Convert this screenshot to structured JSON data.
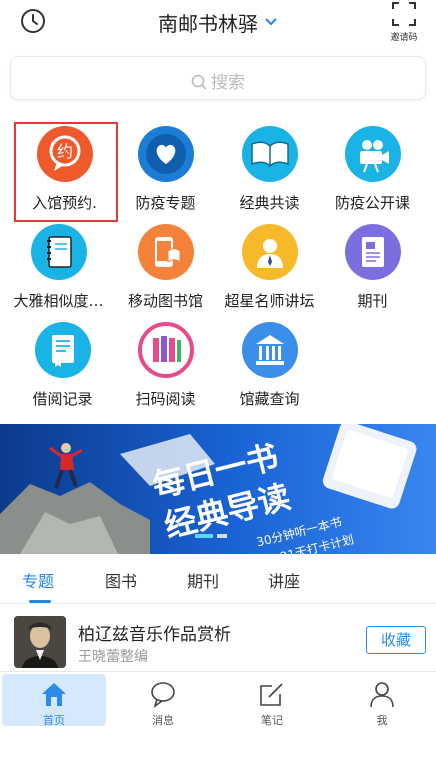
{
  "header": {
    "title": "南邮书林驿",
    "invite_label": "邀请码"
  },
  "search": {
    "placeholder": "搜索"
  },
  "grid": {
    "items": [
      {
        "label": "入馆预约.",
        "icon": "appointment-icon",
        "color": "#ef5a2c",
        "glyph": "约"
      },
      {
        "label": "防疫专题",
        "icon": "heart-icon",
        "color": "#1b7dd6"
      },
      {
        "label": "经典共读",
        "icon": "open-book-icon",
        "color": "#19b3e6"
      },
      {
        "label": "防疫公开课",
        "icon": "video-camera-icon",
        "color": "#19b3e6"
      },
      {
        "label": "大雅相似度…",
        "icon": "notebook-icon",
        "color": "#19b3e6"
      },
      {
        "label": "移动图书馆",
        "icon": "mobile-library-icon",
        "color": "#f5823a"
      },
      {
        "label": "超星名师讲坛",
        "icon": "lecturer-icon",
        "color": "#f5b92a"
      },
      {
        "label": "期刊",
        "icon": "journal-icon",
        "color": "#7b6fe0"
      },
      {
        "label": "借阅记录",
        "icon": "borrow-record-icon",
        "color": "#19b3e6"
      },
      {
        "label": "扫码阅读",
        "icon": "scan-books-icon",
        "color": "#e84b8a"
      },
      {
        "label": "馆藏查询",
        "icon": "library-building-icon",
        "color": "#3b8fe8"
      }
    ]
  },
  "banner": {
    "headline1": "每日一书",
    "headline2": "经典导读",
    "tagline1": "30分钟听一本书",
    "tagline2": "21天打卡计划"
  },
  "tabs": [
    {
      "label": "专题",
      "active": true
    },
    {
      "label": "图书",
      "active": false
    },
    {
      "label": "期刊",
      "active": false
    },
    {
      "label": "讲座",
      "active": false
    }
  ],
  "list": {
    "items": [
      {
        "title": "柏辽兹音乐作品赏析",
        "author": "王晓蕾整编",
        "action": "收藏"
      }
    ]
  },
  "nav": [
    {
      "label": "首页",
      "icon": "home-icon",
      "active": true
    },
    {
      "label": "消息",
      "icon": "message-icon",
      "active": false
    },
    {
      "label": "笔记",
      "icon": "note-icon",
      "active": false
    },
    {
      "label": "我",
      "icon": "profile-icon",
      "active": false
    }
  ],
  "colors": {
    "accent": "#1e88e5",
    "highlight_border": "#e53935"
  }
}
